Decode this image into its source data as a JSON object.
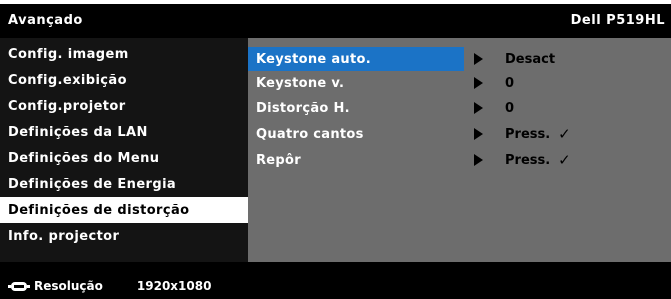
{
  "header": {
    "title": "Avançado",
    "model": "Dell P519HL"
  },
  "menu": {
    "items": [
      {
        "label": "Config. imagem"
      },
      {
        "label": "Config.exibição"
      },
      {
        "label": "Config.projetor"
      },
      {
        "label": "Definições da LAN"
      },
      {
        "label": "Definições do Menu"
      },
      {
        "label": "Definições de Energia"
      },
      {
        "label": "Definições de distorção"
      },
      {
        "label": "Info. projector"
      }
    ],
    "selected": "Definições de distorção"
  },
  "settings": {
    "rows": [
      {
        "label": "Keystone auto.",
        "value": "Desact",
        "mark": ""
      },
      {
        "label": "Keystone v.",
        "value": "0",
        "mark": ""
      },
      {
        "label": "Distorção H.",
        "value": "0",
        "mark": ""
      },
      {
        "label": "Quatro cantos",
        "value": "Press.",
        "mark": "✓"
      },
      {
        "label": "Repôr",
        "value": "Press.",
        "mark": "✓"
      }
    ],
    "highlighted": "Keystone auto."
  },
  "status": {
    "input_icon": "input-source-icon",
    "label": "Resolução",
    "resolution": "1920x1080"
  },
  "colors": {
    "highlight": "#1b73c6",
    "panel": "#6d6d6d",
    "background": "#000000",
    "selected_bg": "#ffffff"
  }
}
